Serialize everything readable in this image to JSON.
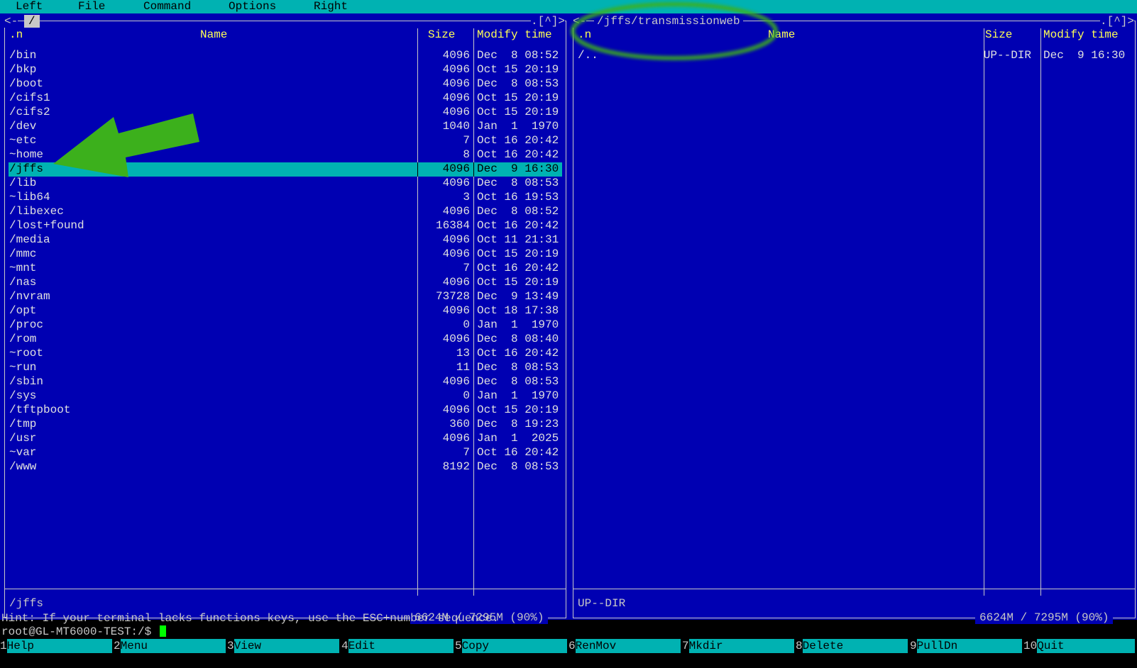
{
  "menu": [
    "Left",
    "File",
    "Command",
    "Options",
    "Right"
  ],
  "left_panel": {
    "path": "/",
    "corner": ".[^]>",
    "corner_left": "<-",
    "headers": {
      "n": ".n",
      "name": "Name",
      "size": "Size",
      "time": "Modify time"
    },
    "files": [
      {
        "name": "/bin",
        "size": "4096",
        "time": "Dec  8 08:52"
      },
      {
        "name": "/bkp",
        "size": "4096",
        "time": "Oct 15 20:19"
      },
      {
        "name": "/boot",
        "size": "4096",
        "time": "Dec  8 08:53"
      },
      {
        "name": "/cifs1",
        "size": "4096",
        "time": "Oct 15 20:19"
      },
      {
        "name": "/cifs2",
        "size": "4096",
        "time": "Oct 15 20:19"
      },
      {
        "name": "/dev",
        "size": "1040",
        "time": "Jan  1  1970"
      },
      {
        "name": "~etc",
        "size": "7",
        "time": "Oct 16 20:42"
      },
      {
        "name": "~home",
        "size": "8",
        "time": "Oct 16 20:42"
      },
      {
        "name": "/jffs",
        "size": "4096",
        "time": "Dec  9 16:30"
      },
      {
        "name": "/lib",
        "size": "4096",
        "time": "Dec  8 08:53"
      },
      {
        "name": "~lib64",
        "size": "3",
        "time": "Oct 16 19:53"
      },
      {
        "name": "/libexec",
        "size": "4096",
        "time": "Dec  8 08:52"
      },
      {
        "name": "/lost+found",
        "size": "16384",
        "time": "Oct 16 20:42"
      },
      {
        "name": "/media",
        "size": "4096",
        "time": "Oct 11 21:31"
      },
      {
        "name": "/mmc",
        "size": "4096",
        "time": "Oct 15 20:19"
      },
      {
        "name": "~mnt",
        "size": "7",
        "time": "Oct 16 20:42"
      },
      {
        "name": "/nas",
        "size": "4096",
        "time": "Oct 15 20:19"
      },
      {
        "name": "/nvram",
        "size": "73728",
        "time": "Dec  9 13:49"
      },
      {
        "name": "/opt",
        "size": "4096",
        "time": "Oct 18 17:38"
      },
      {
        "name": "/proc",
        "size": "0",
        "time": "Jan  1  1970"
      },
      {
        "name": "/rom",
        "size": "4096",
        "time": "Dec  8 08:40"
      },
      {
        "name": "~root",
        "size": "13",
        "time": "Oct 16 20:42"
      },
      {
        "name": "~run",
        "size": "11",
        "time": "Dec  8 08:53"
      },
      {
        "name": "/sbin",
        "size": "4096",
        "time": "Dec  8 08:53"
      },
      {
        "name": "/sys",
        "size": "0",
        "time": "Jan  1  1970"
      },
      {
        "name": "/tftpboot",
        "size": "4096",
        "time": "Oct 15 20:19"
      },
      {
        "name": "/tmp",
        "size": "360",
        "time": "Dec  8 19:23"
      },
      {
        "name": "/usr",
        "size": "4096",
        "time": "Jan  1  2025"
      },
      {
        "name": "~var",
        "size": "7",
        "time": "Oct 16 20:42"
      },
      {
        "name": "/www",
        "size": "8192",
        "time": "Dec  8 08:53"
      }
    ],
    "selected_index": 8,
    "status": "/jffs",
    "free": "6624M / 7295M (90%)"
  },
  "right_panel": {
    "path": "/jffs/transmissionweb",
    "corner": ".[^]>",
    "corner_left": "<-",
    "headers": {
      "n": ".n",
      "name": "Name",
      "size": "Size",
      "time": "Modify time"
    },
    "files": [
      {
        "name": "/..",
        "size": "UP--DIR",
        "time": "Dec  9 16:30"
      }
    ],
    "status": "UP--DIR",
    "free": "6624M / 7295M (90%)"
  },
  "hint": "Hint: If your terminal lacks functions keys, use the ESC+number sequence.",
  "prompt": "root@GL-MT6000-TEST:/$",
  "fkeys": [
    {
      "num": "1",
      "label": "Help"
    },
    {
      "num": "2",
      "label": "Menu"
    },
    {
      "num": "3",
      "label": "View"
    },
    {
      "num": "4",
      "label": "Edit"
    },
    {
      "num": "5",
      "label": "Copy"
    },
    {
      "num": "6",
      "label": "RenMov"
    },
    {
      "num": "7",
      "label": "Mkdir"
    },
    {
      "num": "8",
      "label": "Delete"
    },
    {
      "num": "9",
      "label": "PullDn"
    },
    {
      "num": "10",
      "label": "Quit"
    }
  ],
  "colors": {
    "panel": "#0000b2",
    "menubar": "#00b2b2",
    "header": "#ffff55",
    "annotation": "#3cb01c"
  }
}
